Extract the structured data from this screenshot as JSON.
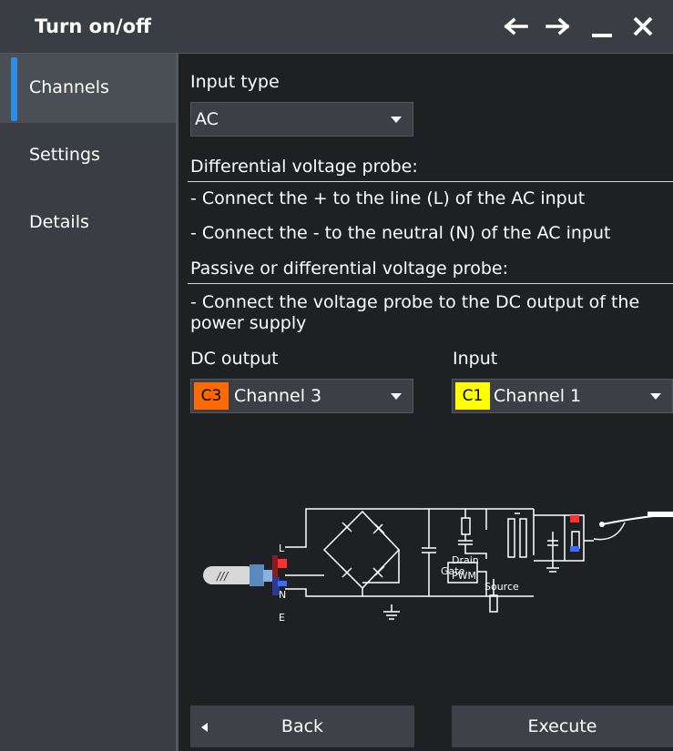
{
  "window": {
    "title": "Turn on/off",
    "buttons": [
      "arrow-left-icon",
      "arrow-right-icon",
      "minimize-icon",
      "close-icon"
    ]
  },
  "sidebar": {
    "items": [
      {
        "label": "Channels",
        "active": true
      },
      {
        "label": "Settings",
        "active": false
      },
      {
        "label": "Details",
        "active": false
      }
    ]
  },
  "main": {
    "input_type_label": "Input type",
    "input_type_value": "AC",
    "diff_probe_heading": "Differential voltage probe:",
    "diff_probe_line1": "- Connect the + to the line (L) of the AC input",
    "diff_probe_line2": "- Connect the - to the neutral (N) of the AC input",
    "passive_probe_heading": "Passive or differential voltage probe:",
    "passive_probe_line1a": "- Connect the voltage probe to the DC output of the",
    "passive_probe_line1b": "power supply",
    "dc_output_label": "DC output",
    "dc_output_chip": "C3",
    "dc_output_value": "Channel 3",
    "input_label": "Input",
    "input_chip": "C1",
    "input_value": "Channel 1",
    "diagram": {
      "L": "L",
      "N": "N",
      "E": "E",
      "drain": "Drain",
      "gate": "Gate",
      "source": "Source",
      "pwm": "PWM",
      "probe_mark": "///"
    },
    "back_label": "Back",
    "execute_label": "Execute"
  },
  "colors": {
    "accent": "#2a8de8",
    "channel3": "#ff6a00",
    "channel1": "#ffff00",
    "titlebar": "#3a3d43",
    "background": "#1f2023"
  }
}
